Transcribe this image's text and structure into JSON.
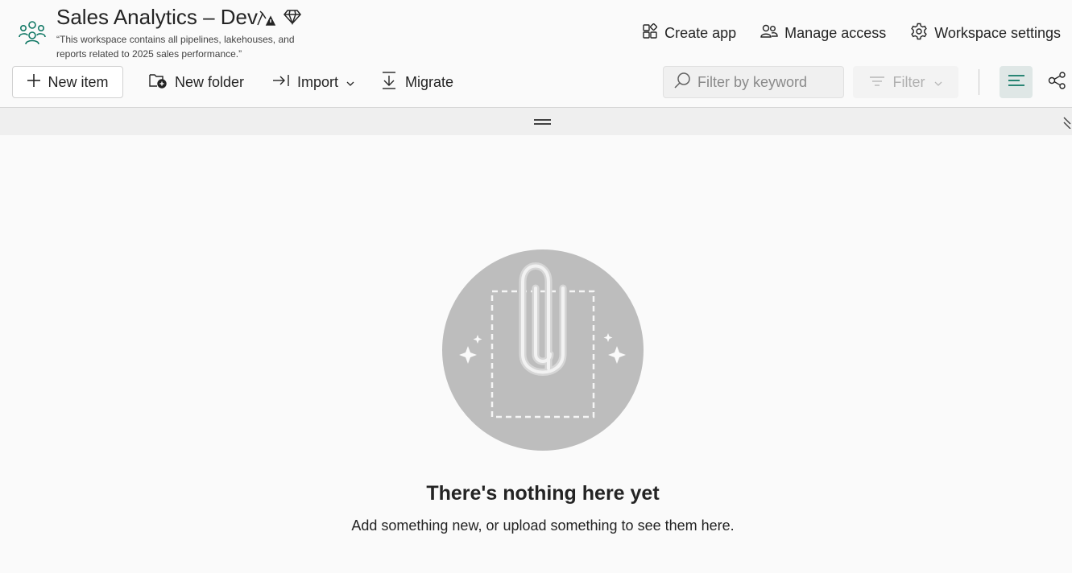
{
  "workspace": {
    "icon": "workspace-people-icon",
    "title": "Sales Analytics – Dev",
    "title_icons": [
      "sensitivity-warning-icon",
      "premium-diamond-icon"
    ],
    "description": "“This workspace contains all pipelines, lakehouses, and reports related to 2025 sales performance.”"
  },
  "header_actions": {
    "create_app": "Create app",
    "manage_access": "Manage access",
    "workspace_settings": "Workspace settings"
  },
  "toolbar": {
    "new_item": "New item",
    "new_folder": "New folder",
    "import": "Import",
    "migrate": "Migrate",
    "search_placeholder": "Filter by keyword",
    "filter": "Filter"
  },
  "empty_state": {
    "title": "There's nothing here yet",
    "subtitle": "Add something new, or upload something to see them here."
  },
  "colors": {
    "accent": "#117865",
    "background": "#fafafa",
    "illustration": "#bdbdbd"
  }
}
